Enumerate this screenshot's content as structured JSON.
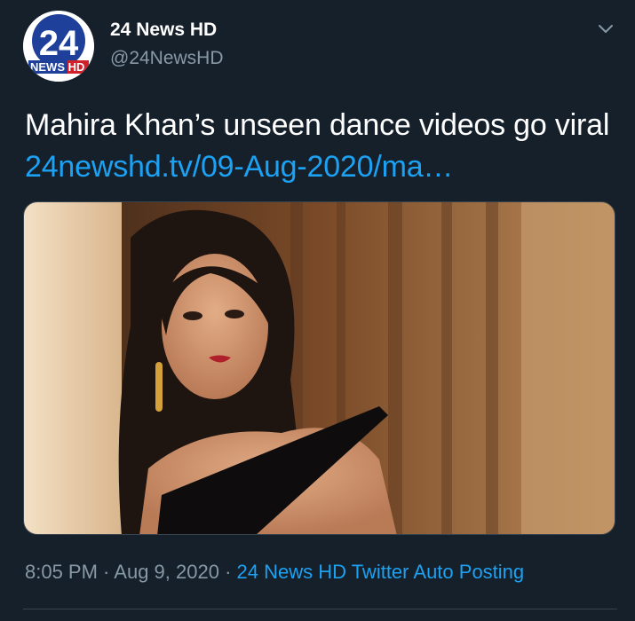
{
  "account": {
    "display_name": "24 News HD",
    "handle": "@24NewsHD",
    "avatar_logo_text": "24",
    "avatar_banner_text": "NEWS HD"
  },
  "tweet": {
    "text": "Mahira Khan’s unseen dance videos go viral ",
    "link_text": "24newshd.tv/09-Aug-2020/ma…"
  },
  "media": {
    "alt": "photo"
  },
  "meta": {
    "time": "8:05 PM",
    "separator1": " · ",
    "date": "Aug 9, 2020",
    "separator2": " · ",
    "source": "24 News HD Twitter Auto Posting"
  },
  "colors": {
    "background": "#15202b",
    "link": "#1da1f2",
    "secondary_text": "#8899a6",
    "border": "#38444d"
  },
  "icons": {
    "menu": "chevron-down-icon"
  }
}
